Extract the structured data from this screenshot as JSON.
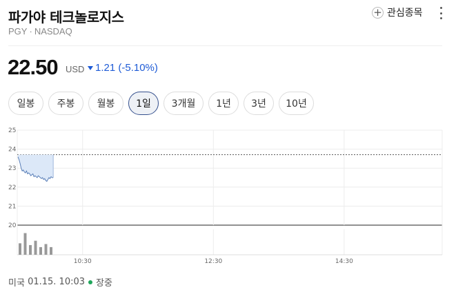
{
  "header": {
    "title": "파가야 테크놀로지스",
    "ticker": "PGY",
    "exchange": "NASDAQ",
    "watch_label": "관심종목"
  },
  "quote": {
    "price": "22.50",
    "currency": "USD",
    "change": "1.21 (-5.10%)",
    "direction": "down",
    "color_down": "#1e5bd6"
  },
  "tabs": [
    {
      "label": "일봉",
      "active": false
    },
    {
      "label": "주봉",
      "active": false
    },
    {
      "label": "월봉",
      "active": false
    },
    {
      "label": "1일",
      "active": true
    },
    {
      "label": "3개월",
      "active": false
    },
    {
      "label": "1년",
      "active": false
    },
    {
      "label": "3년",
      "active": false
    },
    {
      "label": "10년",
      "active": false
    }
  ],
  "chart_data": {
    "type": "line",
    "ylim": [
      20,
      25
    ],
    "y_ticks": [
      "25",
      "24",
      "23",
      "22",
      "21",
      "20"
    ],
    "x_ticks": [
      {
        "label": "10:30",
        "t": 60
      },
      {
        "label": "12:30",
        "t": 180
      },
      {
        "label": "14:30",
        "t": 300
      }
    ],
    "x_range_minutes": [
      0,
      390
    ],
    "previous_close": 23.71,
    "series": [
      {
        "x": [
          0,
          1,
          2,
          3,
          4,
          5,
          6,
          7,
          8,
          9,
          10,
          11,
          12,
          13,
          14,
          15,
          16,
          17,
          18,
          19,
          20,
          21,
          22,
          23,
          24,
          25,
          26,
          27,
          28,
          29,
          30,
          31,
          32,
          33
        ],
        "values": [
          23.6,
          23.45,
          23.25,
          23.0,
          22.85,
          22.9,
          22.8,
          22.75,
          22.85,
          22.7,
          22.75,
          22.7,
          22.6,
          22.65,
          22.7,
          22.55,
          22.6,
          22.55,
          22.5,
          22.6,
          22.55,
          22.5,
          22.45,
          22.5,
          22.4,
          22.45,
          22.35,
          22.3,
          22.4,
          22.5,
          22.45,
          22.55,
          22.5,
          22.5
        ]
      }
    ],
    "volume": [
      0.45,
      0.85,
      0.38,
      0.55,
      0.3,
      0.42,
      0.3
    ],
    "line_color": "#5a7fb8",
    "fill_color": "#dce8f8",
    "volume_color": "#999999"
  },
  "status": {
    "market": "미국",
    "datetime": "01.15. 10:03",
    "state": "장중"
  }
}
